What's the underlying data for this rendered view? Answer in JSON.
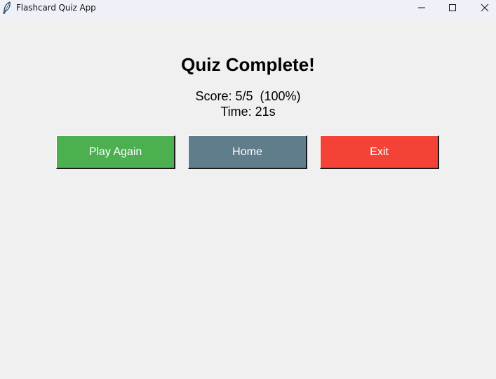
{
  "window": {
    "title": "Flashcard Quiz App",
    "icon": "feather-icon"
  },
  "window_controls": {
    "minimize_icon": "minimize-icon",
    "maximize_icon": "maximize-icon",
    "close_icon": "close-icon"
  },
  "result": {
    "heading": "Quiz Complete!",
    "score_text": "Score: 5/5  (100%)",
    "time_text": "Time: 21s"
  },
  "buttons": {
    "play_again": {
      "label": "Play Again",
      "color": "#4caf50"
    },
    "home": {
      "label": "Home",
      "color": "#607d8b"
    },
    "exit": {
      "label": "Exit",
      "color": "#f44336"
    }
  },
  "colors": {
    "background": "#f0f0f0",
    "titlebar": "#eef2f8"
  }
}
